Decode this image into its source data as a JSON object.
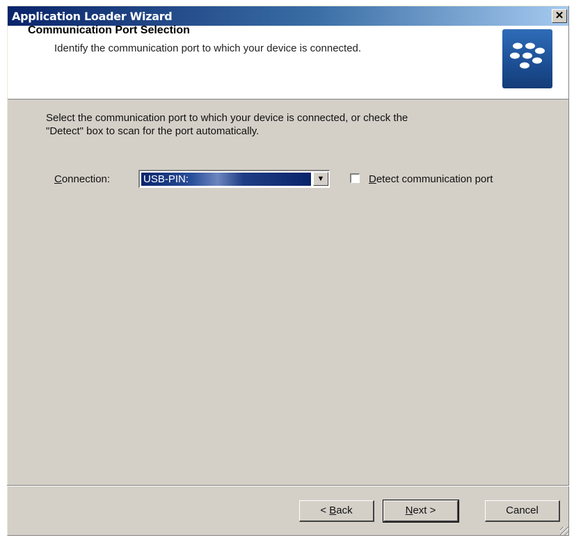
{
  "window": {
    "title": "Application Loader Wizard",
    "close_glyph": "✕"
  },
  "header": {
    "title": "Communication Port Selection",
    "subtitle": "Identify the communication port to which your device is connected.",
    "logo_icon": "blackberry-logo-icon"
  },
  "body": {
    "instructions_line1": "Select the communication port to which your device is connected, or check the",
    "instructions_line2": "\"Detect\" box to scan for the port automatically.",
    "connection_label_accel": "C",
    "connection_label_rest": "onnection:",
    "connection_value": "USB-PIN:",
    "dropdown_arrow": "▼",
    "detect_label_accel": "D",
    "detect_label_rest": "etect communication port",
    "detect_checked": false
  },
  "footer": {
    "back_prefix": "< ",
    "back_accel": "B",
    "back_rest": "ack",
    "next_accel": "N",
    "next_rest": "ext >",
    "cancel_label": "Cancel"
  },
  "colors": {
    "titlebar_start": "#0a246a",
    "titlebar_end": "#a6caf0",
    "dialog_face": "#d4d0c8",
    "selection": "#0a246a"
  }
}
